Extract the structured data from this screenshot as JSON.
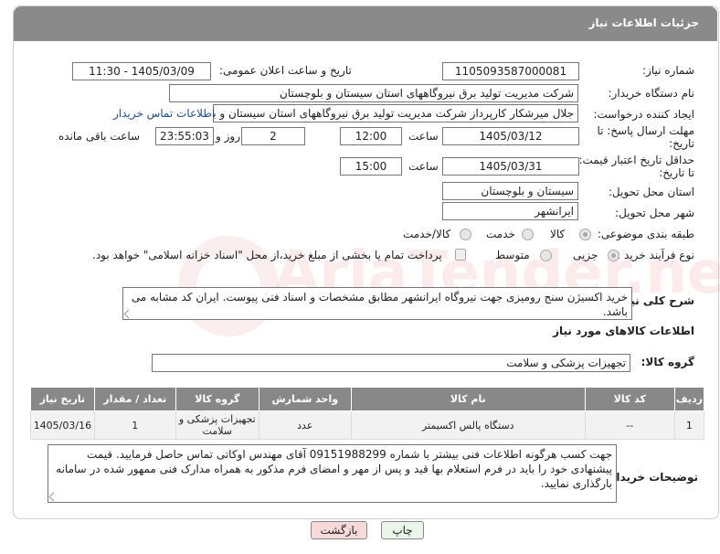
{
  "title": "جزئیات اطلاعات نیاز",
  "fields": {
    "need_number_label": "شماره نیاز:",
    "need_number": "1105093587000081",
    "announce_label": "تاریخ و ساعت اعلان عمومی:",
    "announce_value": "1405/03/09 - 11:30",
    "buyer_label": "نام دستگاه خریدار:",
    "buyer_value": "شرکت مدیریت تولید برق نیروگاههای استان سیستان و بلوچستان",
    "creator_label": "ایجاد کننده درخواست:",
    "creator_value": "جلال میرشکار کارپرداز شرکت مدیریت تولید برق نیروگاههای استان سیستان و با",
    "contact_link": "اطلاعات تماس خریدار",
    "deadline_label_1": "مهلت ارسال پاسخ: تا",
    "deadline_label_2": "تاریخ:",
    "deadline_date": "1405/03/12",
    "time_label": "ساعت",
    "deadline_time": "12:00",
    "days_value": "2",
    "days_label": "روز و",
    "remaining_time": "23:55:03",
    "remaining_label": "ساعت باقی مانده",
    "validity_label_1": "حداقل تاریخ اعتبار قیمت:",
    "validity_label_2": "تا تاریخ:",
    "validity_date": "1405/03/31",
    "validity_time": "15:00",
    "province_label": "استان محل تحویل:",
    "province_value": "سیستان و بلوچستان",
    "city_label": "شهر محل تحویل:",
    "city_value": "ایرانشهر",
    "category_label": "طبقه بندی موضوعی:",
    "category_options": [
      "کالا",
      "خدمت",
      "کالا/خدمت"
    ],
    "process_label": "نوع فرآیند خرید :",
    "process_options": [
      "جزیی",
      "متوسط"
    ],
    "payment_note": "پرداخت تمام یا بخشی از مبلغ خرید،از محل \"اسناد خزانه اسلامی\" خواهد بود.",
    "summary_label": "شرح کلی نیاز:",
    "summary_value": "خرید اکسیژن سنج رومیزی جهت نیروگاه ایرانشهر مطابق مشخصات و اسناد فنی پیوست. ایران کد مشابه می باشد.",
    "goods_info_title": "اطلاعات کالاهای مورد نیاز",
    "goods_group_label": "گروه کالا:",
    "goods_group_value": "تجهیزات پزشکی و سلامت"
  },
  "table": {
    "headers": [
      "ردیف",
      "کد کالا",
      "نام کالا",
      "واحد شمارش",
      "گروه کالا",
      "تعداد / مقدار",
      "تاریخ نیاز"
    ],
    "rows": [
      [
        "1",
        "--",
        "دستگاه پالس اکسیمتر",
        "عدد",
        "تجهیزات پزشکی و سلامت",
        "1",
        "1405/03/16"
      ]
    ]
  },
  "buyer_notes_label": "توضیحات خریدار:",
  "buyer_notes": "جهت کسب هرگونه اطلاعات فنی بیشتر با شماره 09151988299 آقای مهندس اوکاتی تماس حاصل فرمایید. قیمت پیشنهادی خود را باید در فرم استعلام بها قید و پس از مهر و امضای فرم مذکور به همراه مدارک فنی ممهور شده در سامانه بارگذاری نمایید.",
  "buttons": {
    "print": "چاپ",
    "back": "بازگشت"
  },
  "watermark": "AriaTender.neT",
  "colors": {
    "header": "#8a8a8a",
    "link": "#1a4ea0",
    "back_button": "#f7d9d9",
    "print_button": "#eaf6ea"
  }
}
